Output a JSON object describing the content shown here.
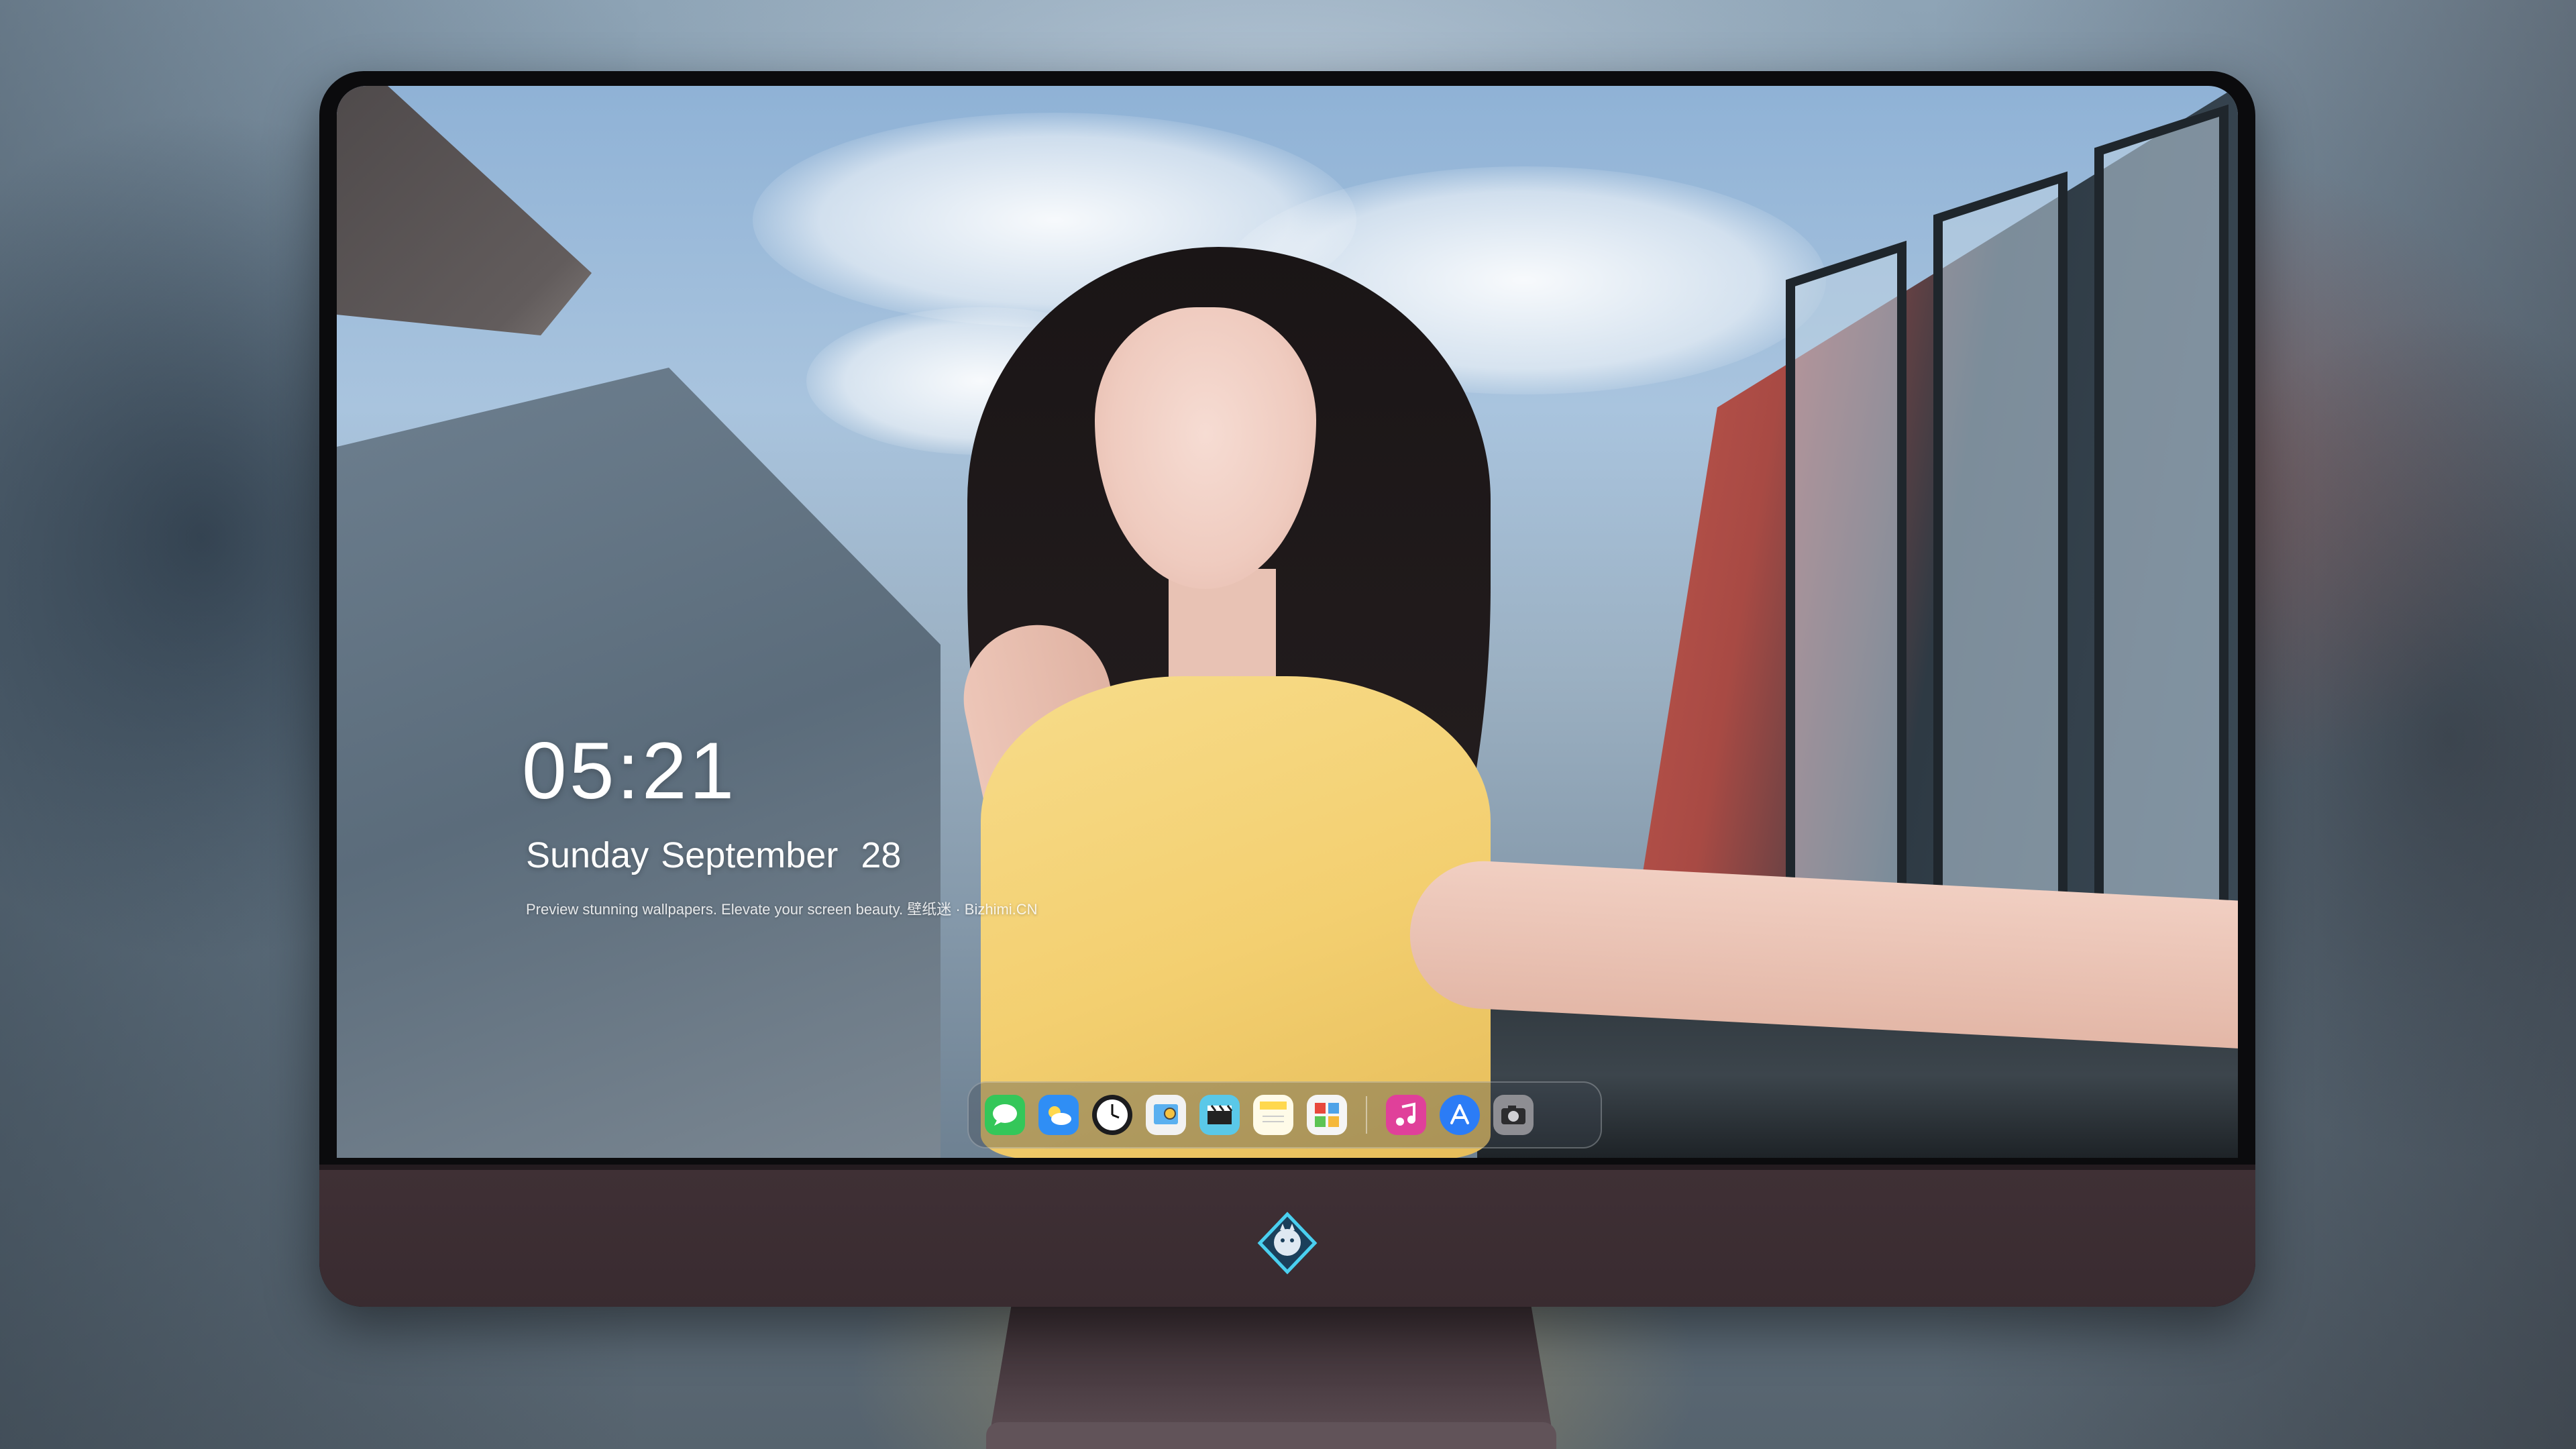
{
  "lockscreen": {
    "time": "05:21",
    "weekday": "Sunday",
    "month": "September",
    "day": "28",
    "tagline": "Preview stunning wallpapers. Elevate your screen beauty. 壁纸迷 · Bizhimi.CN"
  },
  "dock": {
    "apps": [
      {
        "name": "messages-icon",
        "color": "#34c759"
      },
      {
        "name": "weather-icon",
        "color": "#2f8ef5"
      },
      {
        "name": "clock-icon",
        "color": "#1c1c1e"
      },
      {
        "name": "preview-icon",
        "color": "#f2f2f2"
      },
      {
        "name": "final-cut-icon",
        "color": "#5ac8e8"
      },
      {
        "name": "notes-icon",
        "color": "#ffd84d"
      },
      {
        "name": "photo-booth-icon",
        "color": "#f5f5f5"
      },
      {
        "name": "music-icon",
        "color": "#e0409a"
      },
      {
        "name": "app-store-icon",
        "color": "#2b7cf6"
      },
      {
        "name": "camera-icon",
        "color": "#8e8e93"
      }
    ]
  },
  "monitor": {
    "bezel_color": "#0b0b0d",
    "chin_color": "#3f3035",
    "logo_color": "#4ad0f0"
  }
}
